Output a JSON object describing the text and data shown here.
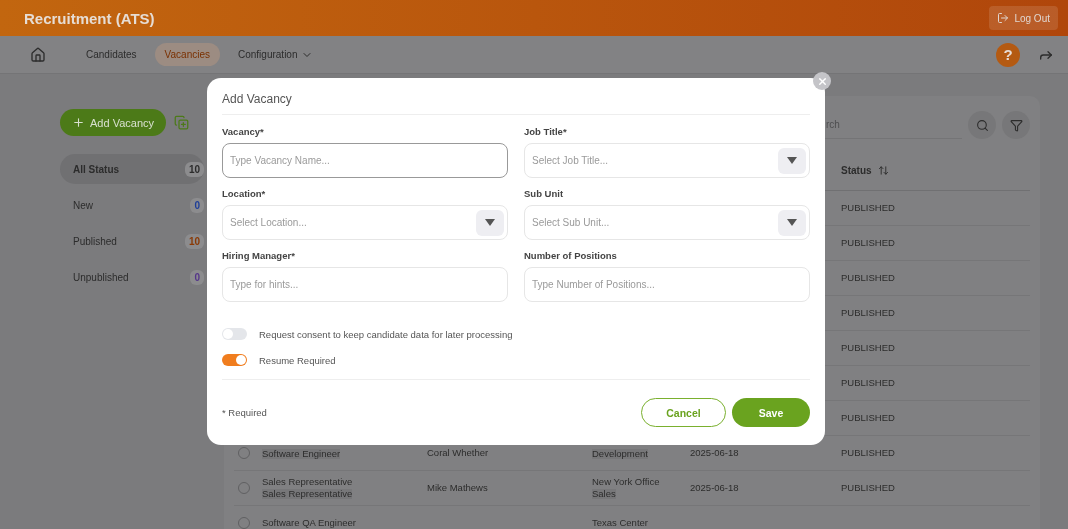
{
  "app": {
    "title": "Recruitment (ATS)",
    "logout": "Log Out"
  },
  "nav": {
    "items": [
      {
        "label": "Candidates",
        "selected": false,
        "dropdown": false
      },
      {
        "label": "Vacancies",
        "selected": true,
        "dropdown": false
      },
      {
        "label": "Configuration",
        "selected": false,
        "dropdown": true
      }
    ],
    "help": "?"
  },
  "sidebar": {
    "add_button": "Add Vacancy",
    "filters": [
      {
        "label": "All Status",
        "count": "10",
        "selected": true,
        "color": "#2c2c2c"
      },
      {
        "label": "New",
        "count": "0",
        "selected": false,
        "color": "#1f3f99"
      },
      {
        "label": "Published",
        "count": "10",
        "selected": false,
        "color": "#8a3a06"
      },
      {
        "label": "Unpublished",
        "count": "0",
        "selected": false,
        "color": "#55368a"
      }
    ]
  },
  "table": {
    "search_placeholder": "rch",
    "status_column": "Status",
    "rows": [
      {
        "status": "PUBLISHED"
      },
      {
        "status": "PUBLISHED"
      },
      {
        "status": "PUBLISHED"
      },
      {
        "status": "PUBLISHED"
      },
      {
        "status": "PUBLISHED"
      },
      {
        "status": "PUBLISHED"
      },
      {
        "status": "PUBLISHED"
      },
      {
        "checked": false,
        "subtitle": "Software Engineer",
        "manager": "Coral Whether",
        "department": "Development",
        "date": "2025-06-18",
        "status": "PUBLISHED"
      },
      {
        "checked": false,
        "title": "Sales Representative",
        "subtitle": "Sales Representative",
        "manager": "Mike Mathews",
        "location": "New York Office",
        "department": "Sales",
        "date": "2025-06-18",
        "status": "PUBLISHED"
      },
      {
        "checked": false,
        "title": "Software QA Engineer",
        "location": "Texas Center"
      }
    ]
  },
  "dialog": {
    "title": "Add Vacancy",
    "fields": [
      {
        "label": "Vacancy*",
        "placeholder": "Type Vacancy Name...",
        "kind": "text",
        "focused": true
      },
      {
        "label": "Job Title*",
        "placeholder": "Select Job Title...",
        "kind": "select",
        "focused": false
      },
      {
        "label": "Location*",
        "placeholder": "Select Location...",
        "kind": "select",
        "focused": false
      },
      {
        "label": "Sub Unit",
        "placeholder": "Select Sub Unit...",
        "kind": "select",
        "focused": false
      },
      {
        "label": "Hiring Manager*",
        "placeholder": "Type for hints...",
        "kind": "text",
        "focused": false
      },
      {
        "label": "Number of Positions",
        "placeholder": "Type Number of Positions...",
        "kind": "text",
        "focused": false
      }
    ],
    "toggles": [
      {
        "label": "Request consent to keep candidate data for later processing",
        "on": false
      },
      {
        "label": "Resume Required",
        "on": true
      }
    ],
    "required_note": "* Required",
    "cancel": "Cancel",
    "save": "Save"
  }
}
